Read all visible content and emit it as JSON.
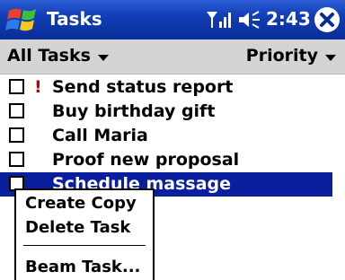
{
  "titlebar": {
    "title": "Tasks",
    "time": "2:43",
    "icons": [
      "windows-start-icon",
      "signal-icon",
      "volume-icon",
      "close-icon"
    ],
    "colors": {
      "bar": "#1240b8"
    }
  },
  "filterbar": {
    "filter_label": "All Tasks",
    "sort_label": "Priority"
  },
  "tasks": [
    {
      "label": "Send status report",
      "priority": "!",
      "checked": false,
      "selected": false
    },
    {
      "label": "Buy birthday gift",
      "priority": "",
      "checked": false,
      "selected": false
    },
    {
      "label": "Call Maria",
      "priority": "",
      "checked": false,
      "selected": false
    },
    {
      "label": "Proof new proposal",
      "priority": "",
      "checked": false,
      "selected": false
    },
    {
      "label": "Schedule massage",
      "priority": "",
      "checked": false,
      "selected": true
    }
  ],
  "context_menu": {
    "items": [
      "Create Copy",
      "Delete Task",
      "Beam Task..."
    ]
  },
  "colors": {
    "selection": "#0a1f9e",
    "priority_high": "#c00000"
  }
}
